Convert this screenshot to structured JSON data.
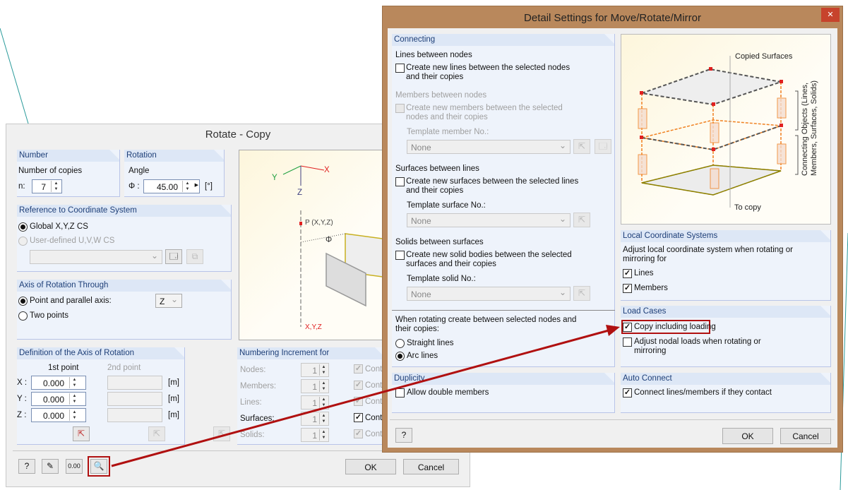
{
  "rotate": {
    "title": "Rotate - Copy",
    "number": {
      "header": "Number",
      "label": "Number of copies",
      "n_label": "n:",
      "n_value": "7"
    },
    "rotation": {
      "header": "Rotation",
      "label": "Angle",
      "phi_label": "Φ :",
      "value": "45.00",
      "unit": "[°]"
    },
    "reference": {
      "header": "Reference to Coordinate System",
      "global": "Global X,Y,Z CS",
      "user": "User-defined U,V,W CS",
      "selected": "global"
    },
    "axis": {
      "header": "Axis of Rotation Through",
      "point": "Point and parallel axis:",
      "two": "Two points",
      "axis_value": "Z",
      "selected": "point"
    },
    "picture": {
      "x": "X",
      "y": "Y",
      "z": "Z",
      "p": "P (X,Y,Z)",
      "phi": "Φ",
      "xyz": "X,Y,Z"
    },
    "definition": {
      "header": "Definition of the Axis of Rotation",
      "first": "1st point",
      "second": "2nd point",
      "rows": [
        {
          "label": "X :",
          "value": "0.000",
          "unit": "[m]"
        },
        {
          "label": "Y :",
          "value": "0.000",
          "unit": "[m]"
        },
        {
          "label": "Z :",
          "value": "0.000",
          "unit": "[m]"
        }
      ]
    },
    "numbering": {
      "header": "Numbering Increment for",
      "rows": [
        {
          "label": "Nodes:",
          "value": "1",
          "check": "Conti",
          "checked": true,
          "enabled": false
        },
        {
          "label": "Members:",
          "value": "1",
          "check": "Conti",
          "checked": true,
          "enabled": false
        },
        {
          "label": "Lines:",
          "value": "1",
          "check": "Conti",
          "checked": true,
          "enabled": false
        },
        {
          "label": "Surfaces:",
          "value": "1",
          "check": "Conti",
          "checked": true,
          "enabled": true
        },
        {
          "label": "Solids:",
          "value": "1",
          "check": "Conti",
          "checked": true,
          "enabled": false
        }
      ]
    },
    "ok": "OK",
    "cancel": "Cancel"
  },
  "detail": {
    "title": "Detail Settings for Move/Rotate/Mirror",
    "close": "✕",
    "connecting": {
      "header": "Connecting",
      "lines_title": "Lines between nodes",
      "lines_cb1": "Create new lines between the selected nodes",
      "lines_cb2": "and their copies",
      "members_title": "Members between nodes",
      "members_cb1": "Create new members between the selected",
      "members_cb2": "nodes and their copies",
      "members_tpl": "Template member No.:",
      "members_sel": "None",
      "surfaces_title": "Surfaces between lines",
      "surfaces_cb1": "Create new surfaces between the selected lines",
      "surfaces_cb2": "and their copies",
      "surfaces_tpl": "Template surface No.:",
      "surfaces_sel": "None",
      "solids_title": "Solids between surfaces",
      "solids_cb1": "Create new solid bodies between the selected",
      "solids_cb2": "surfaces and their copies",
      "solids_tpl": "Template solid No.:",
      "solids_sel": "None",
      "rotating1": "When rotating create between selected nodes and",
      "rotating2": "their copies:",
      "straight": "Straight lines",
      "arc": "Arc lines",
      "selected": "arc"
    },
    "picture": {
      "copied": "Copied Surfaces",
      "connecting1": "Connecting Objects (Lines,",
      "connecting2": "Members, Surfaces, Solids)",
      "tocopy": "To copy"
    },
    "lcs": {
      "header": "Local Coordinate Systems",
      "text1": "Adjust local coordinate system when rotating or",
      "text2": "mirroring for",
      "lines": "Lines",
      "members": "Members",
      "lines_checked": true,
      "members_checked": true
    },
    "load": {
      "header": "Load Cases",
      "copy": "Copy including loading",
      "copy_checked": true,
      "adjust1": "Adjust nodal loads when rotating or",
      "adjust2": "mirroring",
      "adjust_checked": false
    },
    "duplicity": {
      "header": "Duplicity",
      "allow": "Allow double members",
      "checked": false
    },
    "auto": {
      "header": "Auto Connect",
      "connect": "Connect lines/members if they contact",
      "checked": true
    },
    "ok": "OK",
    "cancel": "Cancel"
  },
  "colors": {
    "highlight": "#b01010",
    "titlebar": "#b9885c",
    "group_header": "#dde7f6"
  }
}
